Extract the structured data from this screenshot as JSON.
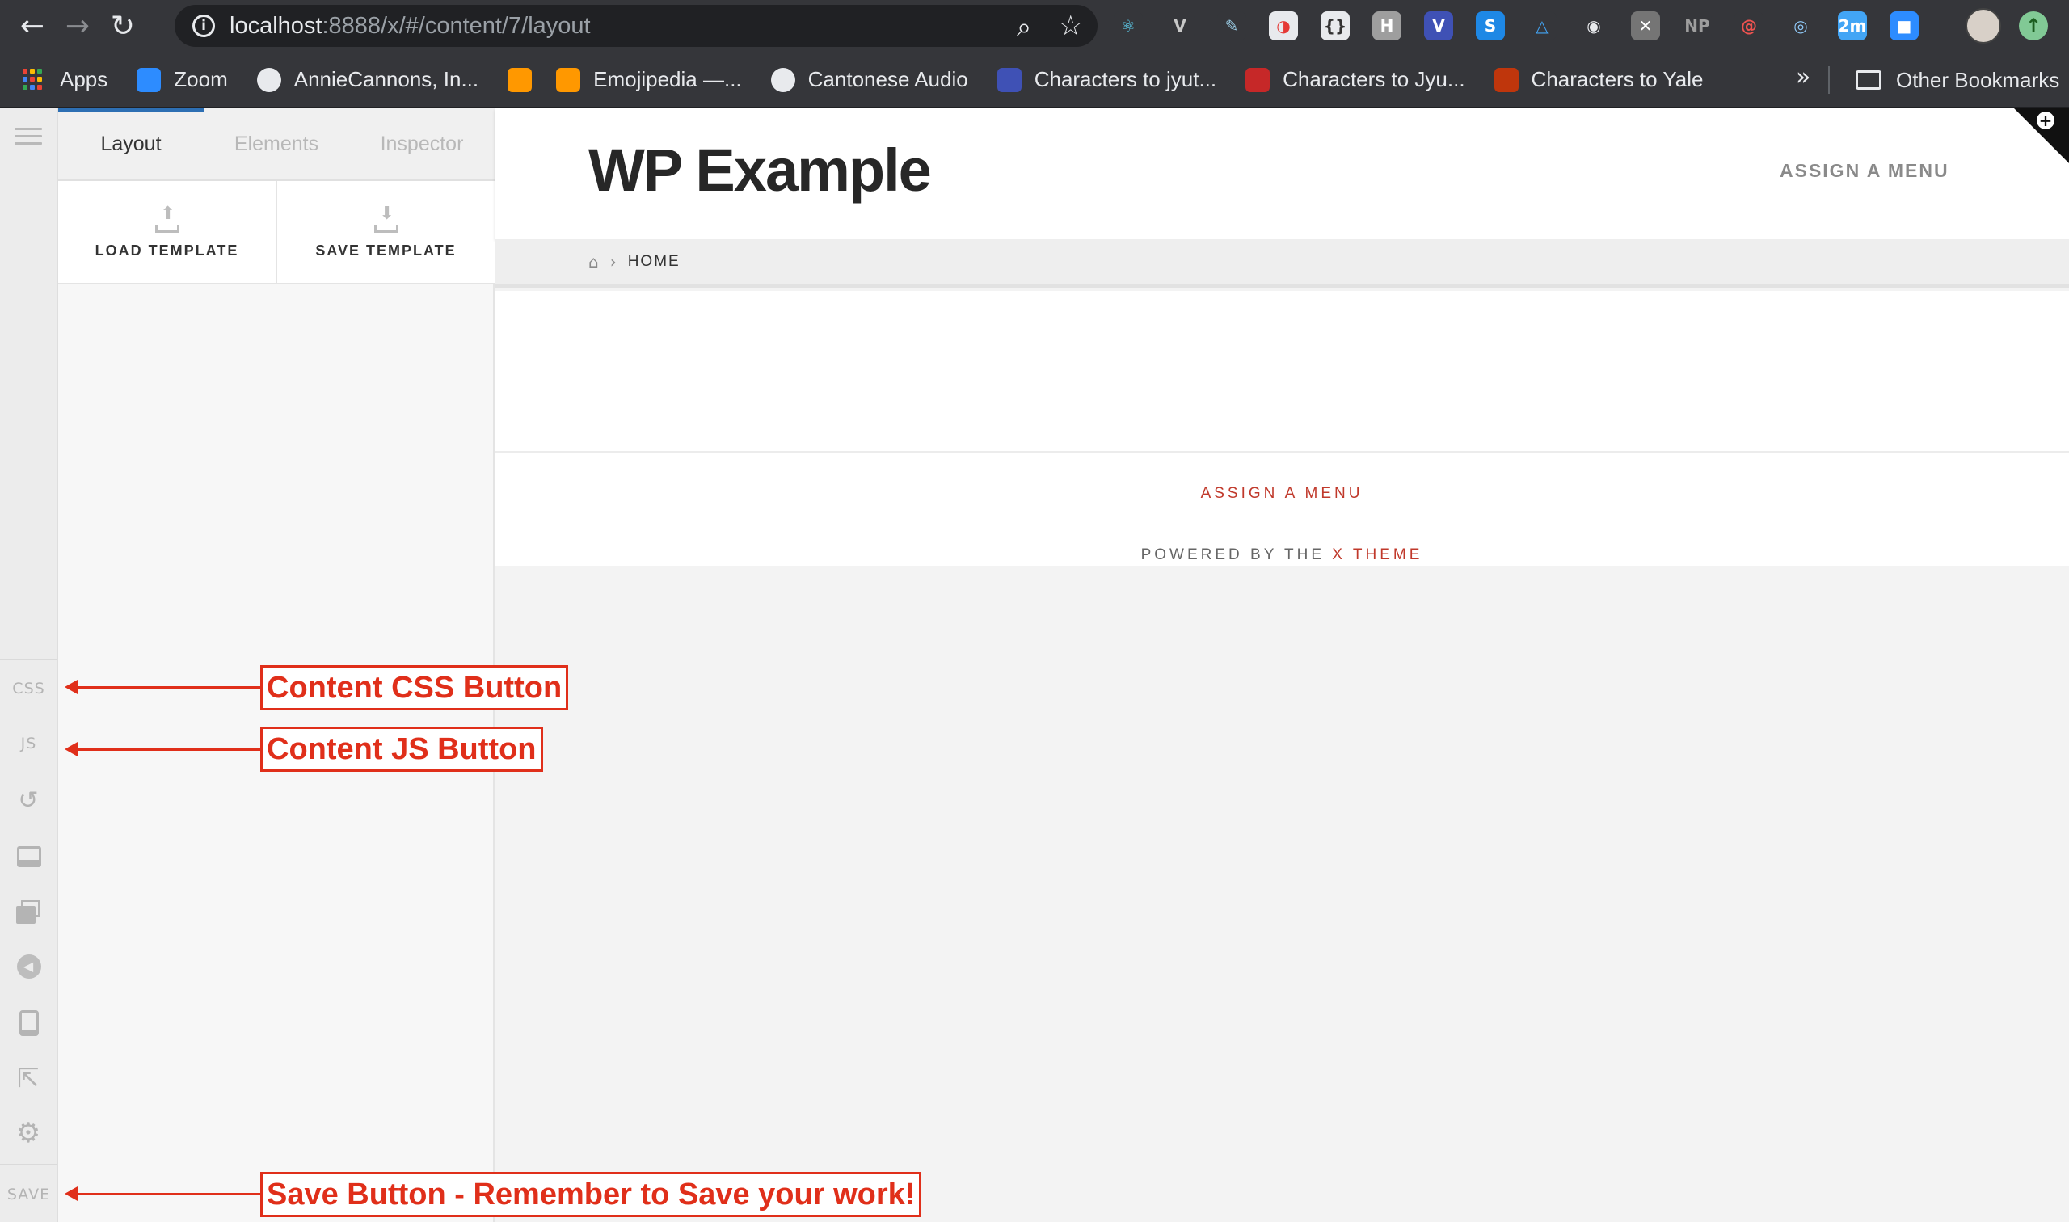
{
  "browser": {
    "url_host": "localhost",
    "url_rest": ":8888/x/#/content/7/layout",
    "extensions": [
      {
        "icon": "react-devtools-icon",
        "glyph": "⚛",
        "bg": "#35363a",
        "fg": "#61dafb"
      },
      {
        "icon": "vue-devtools-icon",
        "glyph": "V",
        "bg": "#35363a",
        "fg": "#c8c8c8"
      },
      {
        "icon": "eyedropper-icon",
        "glyph": "✎",
        "bg": "#35363a",
        "fg": "#9ccfe8"
      },
      {
        "icon": "color-wheel-icon",
        "glyph": "◑",
        "bg": "#e8eaed",
        "fg": "#e53935"
      },
      {
        "icon": "json-formatter-icon",
        "glyph": "{}",
        "bg": "#e8eaed",
        "fg": "#333"
      },
      {
        "icon": "headers-icon",
        "glyph": "H",
        "bg": "#9e9e9e",
        "fg": "#fff"
      },
      {
        "icon": "extension-v-icon",
        "glyph": "V",
        "bg": "#3f51b5",
        "fg": "#fff"
      },
      {
        "icon": "extension-s-icon",
        "glyph": "S",
        "bg": "#1e88e5",
        "fg": "#fff"
      },
      {
        "icon": "triangle-icon",
        "glyph": "△",
        "bg": "#35363a",
        "fg": "#42a5f5"
      },
      {
        "icon": "lens-icon",
        "glyph": "◉",
        "bg": "#35363a",
        "fg": "#e8eaed"
      },
      {
        "icon": "screenshot-icon",
        "glyph": "✕",
        "bg": "#757575",
        "fg": "#fff"
      },
      {
        "icon": "np-icon",
        "glyph": "NP",
        "bg": "#35363a",
        "fg": "#9e9e9e"
      },
      {
        "icon": "swirl-icon",
        "glyph": "@",
        "bg": "#35363a",
        "fg": "#ef5350"
      },
      {
        "icon": "eye-icon",
        "glyph": "◎",
        "bg": "#35363a",
        "fg": "#90caf9"
      },
      {
        "icon": "timer-icon",
        "glyph": "2m",
        "bg": "#42a5f5",
        "fg": "#fff"
      },
      {
        "icon": "zoom-ext-icon",
        "glyph": "■",
        "bg": "#2d8cff",
        "fg": "#fff"
      }
    ]
  },
  "bookmarks": [
    {
      "label": "Apps",
      "icon": "apps-grid-icon"
    },
    {
      "label": "Zoom",
      "icon": "zoom-icon",
      "color": "#2d8cff"
    },
    {
      "label": "AnnieCannons, In...",
      "icon": "github-icon",
      "color": "#e8eaed"
    },
    {
      "label": "",
      "icon": "emoji-icon",
      "color": "#ff9800"
    },
    {
      "label": "Emojipedia —...",
      "icon": "emojipedia-icon",
      "color": "#ff9800"
    },
    {
      "label": "Cantonese Audio",
      "icon": "globe-icon",
      "color": "#e8eaed"
    },
    {
      "label": "Characters to jyut...",
      "icon": "jyutping-icon",
      "color": "#3f51b5"
    },
    {
      "label": "Characters to Jyu...",
      "icon": "chinese-char-icon",
      "color": "#c62828"
    },
    {
      "label": "Characters to Yale",
      "icon": "yale-icon",
      "color": "#bf360c"
    }
  ],
  "bookmarks_overflow": "»",
  "other_bookmarks": "Other Bookmarks",
  "panel": {
    "tabs": [
      "Layout",
      "Elements",
      "Inspector"
    ],
    "active_tab": 0,
    "load_template": "LOAD TEMPLATE",
    "save_template": "SAVE TEMPLATE"
  },
  "rail": {
    "css": "CSS",
    "js": "JS",
    "save": "SAVE"
  },
  "site": {
    "title": "WP Example",
    "header_menu": "ASSIGN A MENU",
    "breadcrumb_home": "HOME",
    "footer_menu": "ASSIGN A MENU",
    "footer_credit_prefix": "POWERED BY THE ",
    "footer_credit_link": "X THEME"
  },
  "annotations": {
    "css": "Content CSS Button",
    "js": "Content JS Button",
    "save": "Save Button - Remember to Save your work!"
  },
  "colors": {
    "accent_red": "#c0392b",
    "annotation_red": "#e02f1a",
    "tab_active_blue": "#2d6fb3"
  }
}
